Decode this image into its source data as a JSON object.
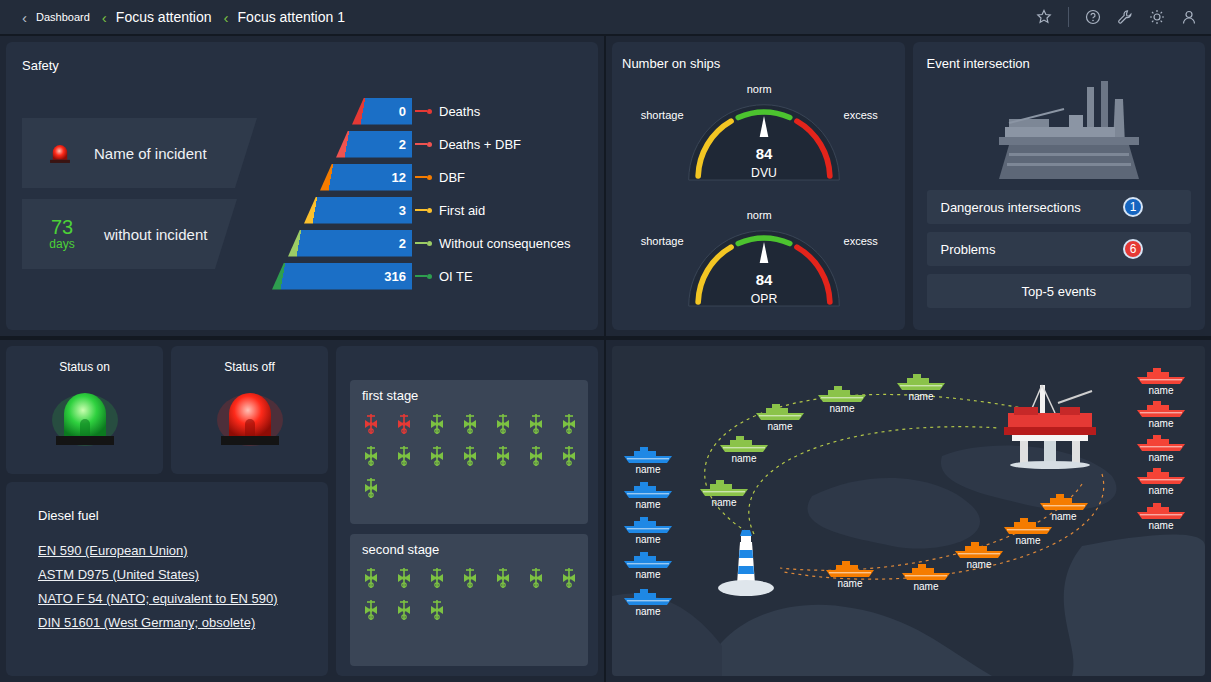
{
  "breadcrumbs": [
    {
      "glyph": "‹",
      "label": "Dashboard",
      "selected": false
    },
    {
      "glyph": "‹",
      "label": "Focus attention",
      "selected": false
    },
    {
      "glyph": "‹",
      "label": "Focus attention 1",
      "selected": true
    }
  ],
  "safety": {
    "title": "Safety",
    "incident": {
      "label": "Name of incident"
    },
    "counter": {
      "value": "73",
      "unit": "days",
      "label": "without incident"
    },
    "levels": [
      {
        "count": "0",
        "label": "Deaths",
        "color": "#e53935"
      },
      {
        "count": "2",
        "label": "Deaths + DBF",
        "color": "#ef5350"
      },
      {
        "count": "12",
        "label": "DBF",
        "color": "#f57c00"
      },
      {
        "count": "3",
        "label": "First aid",
        "color": "#fbc02d"
      },
      {
        "count": "2",
        "label": "Without consequences",
        "color": "#9ccc65"
      },
      {
        "count": "316",
        "label": "OI TE",
        "color": "#2e9e4f"
      }
    ]
  },
  "ships_count": {
    "title": "Number on ships",
    "gauges": [
      {
        "value": "84",
        "label": "DVU",
        "level": 0.5,
        "norm": "norm",
        "shortage": "shortage",
        "excess": "excess"
      },
      {
        "value": "84",
        "label": "OPR",
        "level": 0.5,
        "norm": "norm",
        "shortage": "shortage",
        "excess": "excess"
      }
    ]
  },
  "events": {
    "title": "Event intersection",
    "rows": [
      {
        "label": "Dangerous intersections",
        "count": "1",
        "color": "#1565c0"
      },
      {
        "label": "Problems",
        "count": "6",
        "color": "#e53935"
      }
    ],
    "button": "Top-5 events"
  },
  "status": [
    {
      "label": "Status on",
      "on": true
    },
    {
      "label": "Status off",
      "on": false
    }
  ],
  "diesel": {
    "title": "Diesel fuel",
    "links": [
      "EN 590 (European Union)",
      "ASTM D975 (United States)",
      "NATO F 54 (NATO; equivalent to EN 590)",
      "DIN 51601 (West Germany; obsolete)"
    ]
  },
  "stages": [
    {
      "title": "first stage",
      "valves": [
        {
          "color": "#e53935"
        },
        {
          "color": "#e53935"
        },
        {
          "color": "#7cc242"
        },
        {
          "color": "#7cc242"
        },
        {
          "color": "#7cc242"
        },
        {
          "color": "#7cc242"
        },
        {
          "color": "#7cc242"
        },
        {
          "color": "#7cc242"
        },
        {
          "color": "#7cc242"
        },
        {
          "color": "#7cc242"
        },
        {
          "color": "#7cc242"
        },
        {
          "color": "#7cc242"
        },
        {
          "color": "#7cc242"
        },
        {
          "color": "#7cc242"
        },
        {
          "color": "#7cc242"
        }
      ]
    },
    {
      "title": "second stage",
      "valves": [
        {
          "color": "#7cc242"
        },
        {
          "color": "#7cc242"
        },
        {
          "color": "#7cc242"
        },
        {
          "color": "#7cc242"
        },
        {
          "color": "#7cc242"
        },
        {
          "color": "#7cc242"
        },
        {
          "color": "#7cc242"
        },
        {
          "color": "#7cc242"
        },
        {
          "color": "#7cc242"
        },
        {
          "color": "#7cc242"
        }
      ]
    }
  ],
  "map": {
    "groups": [
      {
        "color": "#1e88e5",
        "ships": [
          {
            "name": "name"
          },
          {
            "name": "name"
          },
          {
            "name": "name"
          },
          {
            "name": "name"
          },
          {
            "name": "name"
          }
        ]
      },
      {
        "color": "#8bc34a",
        "ships": [
          {
            "name": "name"
          },
          {
            "name": "name"
          },
          {
            "name": "name"
          },
          {
            "name": "name"
          },
          {
            "name": "name"
          }
        ]
      },
      {
        "color": "#f57c00",
        "ships": [
          {
            "name": "name"
          },
          {
            "name": "name"
          },
          {
            "name": "name"
          },
          {
            "name": "name"
          },
          {
            "name": "name"
          }
        ]
      },
      {
        "color": "#f44336",
        "ships": [
          {
            "name": "name"
          },
          {
            "name": "name"
          },
          {
            "name": "name"
          },
          {
            "name": "name"
          },
          {
            "name": "name"
          }
        ]
      }
    ]
  }
}
